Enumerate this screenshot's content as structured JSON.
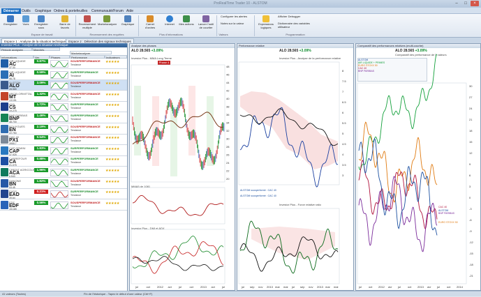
{
  "window": {
    "title": "ProRealTime Trader 10 - ALSTOM"
  },
  "menu": {
    "items": [
      "Démarrer",
      "Outils",
      "Graphique",
      "Ordres & portefeuilles",
      "Communauté/Forum",
      "Aide"
    ]
  },
  "ribbon": {
    "buttons": [
      "Enregistrer",
      "Vues",
      "Enregistrer sous",
      "Barre de favoris",
      "Recensement multiple",
      "Marketanalyzer",
      "Graphique",
      "Carnet d'ordres",
      "Internet",
      "Mes actions",
      "Lancer l'outil de courtier",
      "Configurer les alertes",
      "Notes sur la valeur",
      "Expressions logiques",
      "Afficher Debugger",
      "Dictionnaire des variables utilisateur"
    ],
    "groups": [
      "Espace de travail",
      "Recensement des requêtes",
      "Plus d'informations",
      "Valeurs",
      "Programmation"
    ]
  },
  "tabs": [
    "Espace 1 : Analyse de la situation technique",
    "Espace 2 : Détection des signaux techniques"
  ],
  "left": {
    "header": "Investor Plus - Analyse de la situation technique",
    "selectors": {
      "period": "Période analysée",
      "market": "Marchés",
      "list_label": "Marketanalyzer"
    },
    "columns": [
      "Informations",
      "Var.",
      "Phases",
      "Performance",
      "Indicateurs"
    ],
    "rows": [
      {
        "ticker": "AIR LIQUIDE",
        "sym": "AC",
        "price": "37.33",
        "chg": "0.87%",
        "up": true,
        "perf": "SOUSPERFORMANCE",
        "tend": "Tendance",
        "color": "#1f5fa8"
      },
      {
        "ticker": "AIR LIQUIDE",
        "sym": "AI",
        "price": "96.78",
        "chg": "0.59%",
        "up": true,
        "perf": "SURPERFORMANCE",
        "tend": "Tendance",
        "color": "#2b6fb6"
      },
      {
        "ticker": "ALSTOM",
        "sym": "ALO",
        "price": "28.565",
        "chg": "3.09%",
        "up": true,
        "perf": "SOUSPERFORMANCE",
        "tend": "Tendance",
        "color": "#3a5a8c"
      },
      {
        "ticker": "ARCELORMITTAL",
        "sym": "MT",
        "price": "13.151",
        "chg": "1.32%",
        "up": true,
        "perf": "SOUSPERFORMANCE",
        "tend": "Tendance",
        "color": "#c4442a"
      },
      {
        "ticker": "AXA",
        "sym": "CS",
        "price": "19.275",
        "chg": "1.72%",
        "up": true,
        "perf": "SURPERFORMANCE",
        "tend": "Tendance",
        "color": "#1c3f8c"
      },
      {
        "ticker": "BNP PARIBAS",
        "sym": "BNP",
        "price": "48.700",
        "chg": "1.46%",
        "up": true,
        "perf": "SURPERFORMANCE",
        "tend": "Tendance",
        "color": "#168455"
      },
      {
        "ticker": "BOUYGUES",
        "sym": "EN",
        "price": "22.750",
        "chg": "2.19%",
        "up": true,
        "perf": "SOUSPERFORMANCE",
        "tend": "Tendance",
        "color": "#2f6db1"
      },
      {
        "ticker": "CAC 40",
        "sym": "PX1",
        "price": "3955.7",
        "chg": "0.54%",
        "up": true,
        "perf": "SOUSPERFORMANCE",
        "tend": "Tendance",
        "color": "#7c8a99"
      },
      {
        "ticker": "CAP GEMINI",
        "sym": "CAP",
        "price": "37.925",
        "chg": "1.83%",
        "up": true,
        "perf": "SURPERFORMANCE",
        "tend": "Tendance",
        "color": "#2a79c0"
      },
      {
        "ticker": "CARREFOUR",
        "sym": "CA",
        "price": "21.075",
        "chg": "0.88%",
        "up": true,
        "perf": "SURPERFORMANCE",
        "tend": "Tendance",
        "color": "#1d4fa3"
      },
      {
        "ticker": "CREDIT AGRICOLE",
        "sym": "ACA",
        "price": "6.543",
        "chg": "1.96%",
        "up": true,
        "perf": "SURPERFORMANCE",
        "tend": "Tendance",
        "color": "#0f7a5c"
      },
      {
        "ticker": "DANONE",
        "sym": "BN",
        "price": "53.45",
        "chg": "1.82%",
        "up": true,
        "perf": "SOUSPERFORMANCE",
        "tend": "Tendance",
        "color": "#2658a6"
      },
      {
        "ticker": "EADS",
        "sym": "EAD",
        "price": "39.64",
        "chg": "0.21%",
        "up": false,
        "perf": "SURPERFORMANCE",
        "tend": "Tendance",
        "color": "#23458e"
      },
      {
        "ticker": "EDF",
        "sym": "EDF",
        "price": "15.165",
        "chg": "0.56%",
        "up": true,
        "perf": "SOUSPERFORMANCE",
        "tend": "Tendance",
        "color": "#2a64b8"
      }
    ]
  },
  "panel_phases": {
    "title": "Analyse des phases",
    "symbol": "ALO",
    "price": "28.565",
    "chg": "+3.09%",
    "badge": "Phase 4",
    "indicator": "Investor Plus - MMA Long Terme",
    "sub1": "MMA5 de 1081",
    "sub2": "Investor Plus - DMI et ADX",
    "yticks": [
      "48",
      "46",
      "44",
      "42",
      "40",
      "38",
      "36",
      "34",
      "32",
      "30",
      "28",
      "26",
      "24",
      "22",
      "20"
    ],
    "xticks": [
      "jul",
      "oct",
      "2012",
      "avr",
      "jul",
      "oct",
      "2013",
      "avr",
      "jul"
    ]
  },
  "panel_perf": {
    "title": "Performance relative",
    "symbol": "ALO",
    "price": "28.565",
    "chg": "+3.09%",
    "indicator": "Investor Plus - Analyse de la performance relative",
    "legend1": "ALSTOM sousperformé : CAC 40",
    "legend2": "ALSTOM sousperformé : CAC 40",
    "sub": "Investor Plus - Force relative ratio",
    "xticks": [
      "jul",
      "sep",
      "nov",
      "2013",
      "mar",
      "mai",
      "jul",
      "sep",
      "nov",
      "2013",
      "mar",
      "mai"
    ]
  },
  "panel_compare": {
    "title": "Comparatif des performances relatives (multi-courbe)",
    "symbol": "ALO",
    "price": "28.565",
    "chg": "+3.09%",
    "indicator": "Comparatif des performance de 5 valeurs",
    "legend": [
      "ALSTOM",
      "AIR LIQUIDE + PRIMES",
      "EURO STOXX 50",
      "CAC 40",
      "BNP PARIBAS"
    ],
    "labels": [
      "ALSTOM",
      "CAC 40",
      "BNP PARIBAS",
      "EURO STOXX 50"
    ],
    "xticks": [
      "jul",
      "oct",
      "2012",
      "avr",
      "jul",
      "oct",
      "2013",
      "avr",
      "jul",
      "oct",
      "2014"
    ]
  },
  "status": {
    "left": "41 valeurs (Toutes)",
    "middle": "Fin de l'historique - Tapez le début d'une valeur (Ctrl+F)"
  }
}
